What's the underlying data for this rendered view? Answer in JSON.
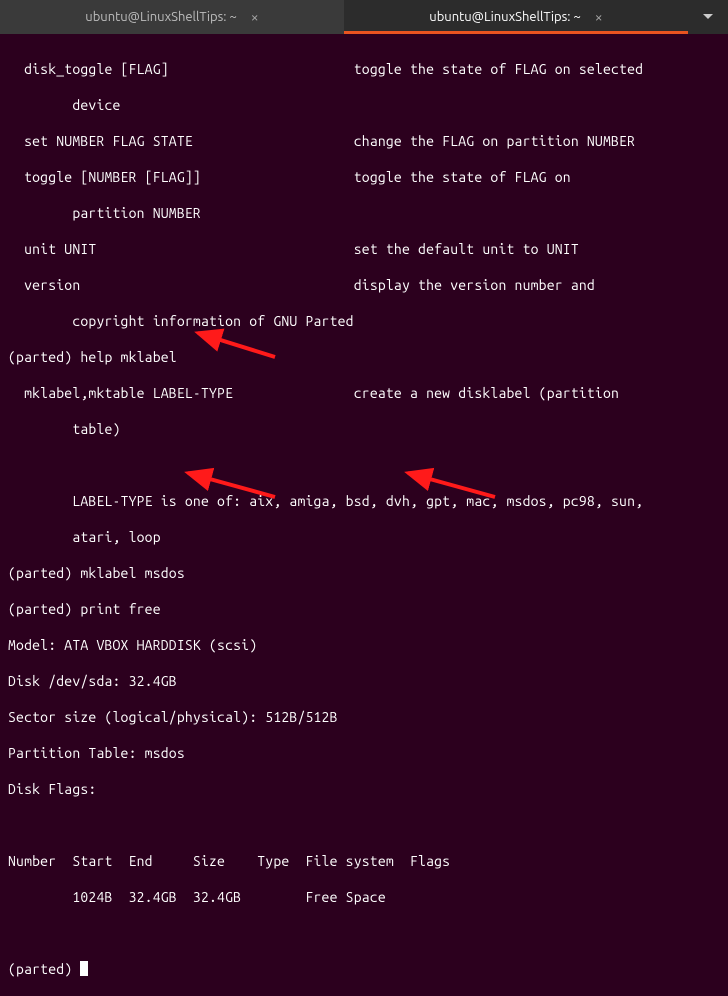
{
  "tabs": {
    "tab1": {
      "title": "ubuntu@LinuxShellTips: ~"
    },
    "tab2": {
      "title": "ubuntu@LinuxShellTips: ~"
    }
  },
  "help": {
    "disk_toggle_cmd": "  disk_toggle [FLAG]",
    "disk_toggle_desc": "toggle the state of FLAG on selected",
    "disk_toggle_cont": "        device",
    "set_cmd": "  set NUMBER FLAG STATE",
    "set_desc": "change the FLAG on partition NUMBER",
    "toggle_cmd": "  toggle [NUMBER [FLAG]]",
    "toggle_desc": "toggle the state of FLAG on",
    "toggle_cont": "        partition NUMBER",
    "unit_cmd": "  unit UNIT",
    "unit_desc": "set the default unit to UNIT",
    "version_cmd": "  version",
    "version_desc": "display the version number and",
    "version_cont": "        copyright information of GNU Parted"
  },
  "session": {
    "help_mklabel": "(parted) help mklabel",
    "mklabel_cmd1": "  mklabel,mktable LABEL-TYPE",
    "mklabel_desc": "create a new disklabel (partition",
    "mklabel_cont": "        table)",
    "labeltype": "\tLABEL-TYPE is one of: aix, amiga, bsd, dvh, gpt, mac, msdos, pc98, sun,",
    "labeltype_cont": "        atari, loop",
    "cmd_mklabel": "(parted) mklabel msdos",
    "cmd_printfree": "(parted) print free",
    "model": "Model: ATA VBOX HARDDISK (scsi)",
    "disk": "Disk /dev/sda: 32.4GB",
    "sector": "Sector size (logical/physical): 512B/512B",
    "ptable": "Partition Table: msdos",
    "dflags": "Disk Flags:",
    "table_header": "Number  Start  End     Size    Type  File system  Flags",
    "table_row": "        1024B  32.4GB  32.4GB        Free Space",
    "prompt": "(parted) "
  }
}
